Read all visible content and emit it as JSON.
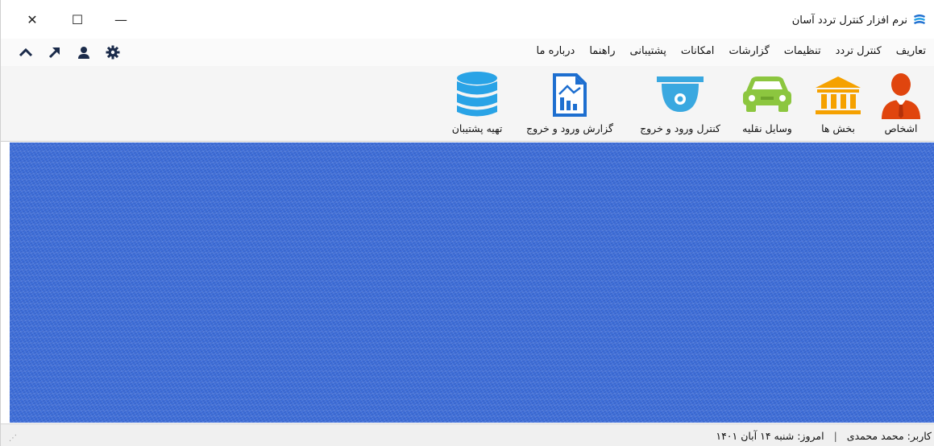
{
  "window": {
    "title": "نرم افزار کنترل تردد آسان",
    "controls": {
      "close": "✕",
      "maximize": "☐",
      "minimize": "—"
    }
  },
  "menu": {
    "items": [
      "تعاریف",
      "کنترل تردد",
      "تنظیمات",
      "گزارشات",
      "امکانات",
      "پشتیبانی",
      "راهنما",
      "درباره ما"
    ]
  },
  "quick_icons": [
    "chevron-up-icon",
    "arrow-up-right-icon",
    "user-icon",
    "gear-icon"
  ],
  "ribbon": {
    "buttons": [
      {
        "label": "اشخاص",
        "icon": "person-icon"
      },
      {
        "label": "بخش ها",
        "icon": "building-icon"
      },
      {
        "label": "وسایل نقلیه",
        "icon": "car-icon"
      },
      {
        "label": "کنترل ورود و خروج",
        "icon": "camera-icon"
      },
      {
        "label": "گزارش ورود و خروج",
        "icon": "report-icon"
      },
      {
        "label": "تهیه پشتیبان",
        "icon": "database-icon"
      }
    ]
  },
  "status": {
    "today": "امروز: شنبه ۱۴ آبان ۱۴۰۱",
    "separator": "|",
    "user": "کاربر: محمد محمدی"
  },
  "colors": {
    "person": "#e0450e",
    "building": "#f5a100",
    "car": "#8cc63f",
    "camera": "#3aa8e0",
    "report": "#1e6fd0",
    "database": "#29a3e6",
    "quick_icons": "#1b2b4a",
    "content_bg": "#3f6fd9"
  }
}
